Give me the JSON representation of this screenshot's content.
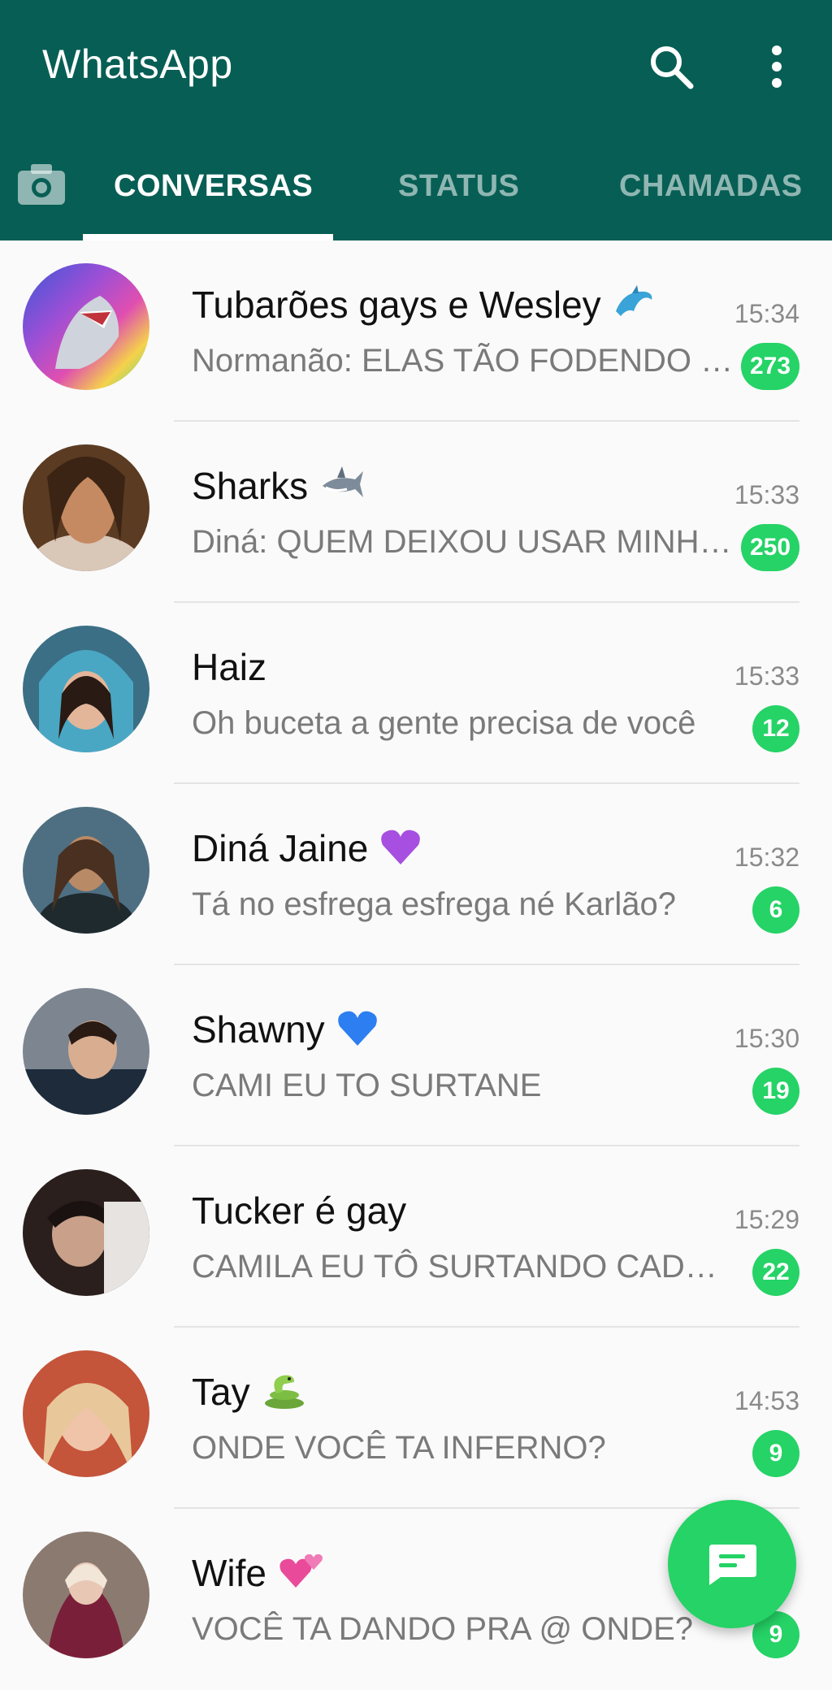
{
  "app": {
    "title": "WhatsApp"
  },
  "toolbar": {
    "search_icon": "search-icon",
    "menu_icon": "more-vertical-icon"
  },
  "tabs": [
    {
      "label": "CONVERSAS",
      "active": true
    },
    {
      "label": "STATUS",
      "active": false
    },
    {
      "label": "CHAMADAS",
      "active": false
    }
  ],
  "colors": {
    "primary": "#075e54",
    "accent": "#25d366",
    "indicator": "#ffffff"
  },
  "chats": [
    {
      "name": "Tubarões gays e Wesley",
      "emoji": "dolphin",
      "time": "15:34",
      "message": "Normanão: ELAS TÃO FODENDO …",
      "unread": "273"
    },
    {
      "name": "Sharks",
      "emoji": "shark",
      "time": "15:33",
      "message": "Diná: QUEM DEIXOU USAR MINHA…",
      "unread": "250"
    },
    {
      "name": "Haiz",
      "emoji": "",
      "time": "15:33",
      "message": "Oh buceta a gente precisa de você",
      "unread": "12"
    },
    {
      "name": "Diná Jaine",
      "emoji": "purple-heart",
      "time": "15:32",
      "message": "Tá no esfrega esfrega né Karlão?",
      "unread": "6"
    },
    {
      "name": "Shawny",
      "emoji": "blue-heart",
      "time": "15:30",
      "message": "CAMI EU TO SURTANE",
      "unread": "19"
    },
    {
      "name": "Tucker é gay",
      "emoji": "",
      "time": "15:29",
      "message": "CAMILA EU TÔ SURTANDO CADE …",
      "unread": "22"
    },
    {
      "name": "Tay",
      "emoji": "snake",
      "time": "14:53",
      "message": "ONDE VOCÊ TA INFERNO?",
      "unread": "9"
    },
    {
      "name": "Wife",
      "emoji": "two-hearts",
      "time": "",
      "message": "VOCÊ TA DANDO PRA @ ONDE?",
      "unread": "9"
    }
  ],
  "fab": {
    "icon": "new-chat-icon"
  }
}
